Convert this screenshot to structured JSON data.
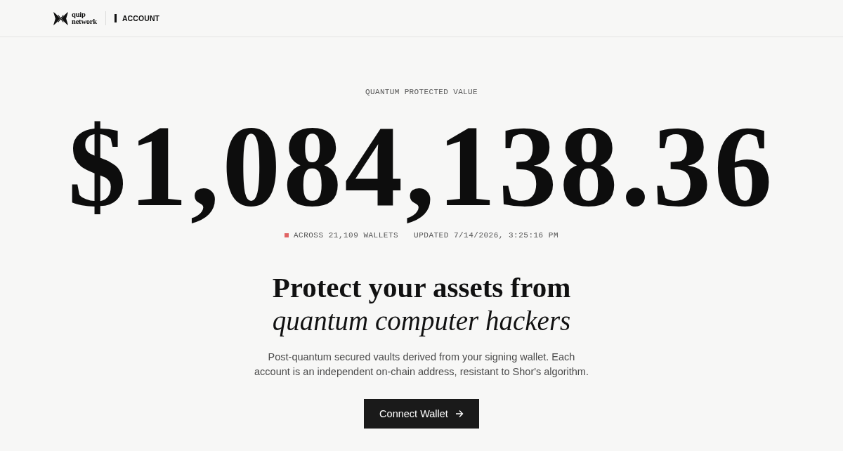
{
  "header": {
    "logo_text": "quip network",
    "section": "ACCOUNT"
  },
  "hero": {
    "label": "QUANTUM PROTECTED VALUE",
    "value": "$1,084,138.36",
    "wallets": "ACROSS 21,109 WALLETS",
    "updated": "UPDATED 7/14/2026, 3:25:16 PM"
  },
  "pitch": {
    "title": "Protect your assets from",
    "title_italic": "quantum computer hackers",
    "description": "Post-quantum secured vaults derived from your signing wallet. Each account is an independent on-chain address, resistant to Shor's algorithm.",
    "button": "Connect Wallet"
  }
}
